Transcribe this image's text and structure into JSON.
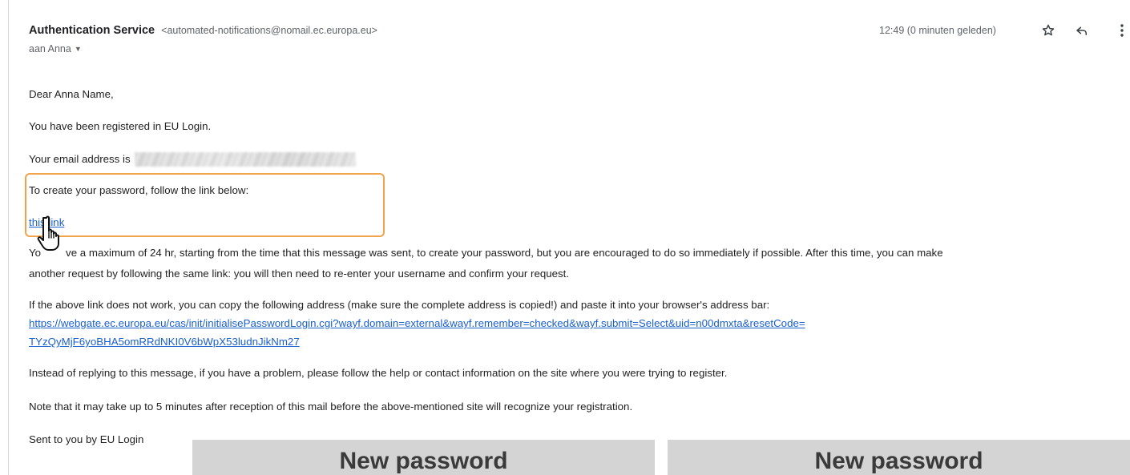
{
  "email": {
    "sender_name": "Authentication Service",
    "sender_address": "<automated-notifications@nomail.ec.europa.eu>",
    "recipient": "aan Anna",
    "timestamp": "12:49 (0 minuten geleden)",
    "icons": {
      "star": "star-icon",
      "reply": "reply-icon",
      "more": "more-vert-icon",
      "caret": "chevron-down-icon"
    }
  },
  "body": {
    "greeting": "Dear Anna Name,",
    "registered": "You have been registered in EU Login.",
    "email_address_label": "Your email address is",
    "create_password": "To create your password, follow the link below:",
    "this_link": "this link",
    "maximum_line_1_start": "Yo",
    "maximum_line_1_rest": "ve a maximum of 24 hr, starting from the time that this message was sent, to create your password, but you are encouraged to do so immediately if possible. After this time, you can make",
    "maximum_line_2": "another request by following the same link: you will then need to re-enter your username and confirm your request.",
    "copy_address": "If the above link does not work, you can copy the following address (make sure the complete address is copied!) and paste it into your browser's address bar:",
    "url_line_1": "https://webgate.ec.europa.eu/cas/init/initialisePasswordLogin.cgi?wayf.domain=external&wayf.remember=checked&wayf.submit=Select&uid=n00dmxta&resetCode=",
    "url_line_2": "TYzQyMjF6yoBHA5omRRdNKI0V6bWpX53ludnJikNm27",
    "instead_reply": "Instead of replying to this message, if you have a problem, please follow the help or contact information on the site where you were trying to register.",
    "note_minutes": "Note that it may take up to 5 minutes after reception of this mail before the above-mentioned site will recognize your registration.",
    "sent_by": "Sent to you by EU Login"
  },
  "overlay": {
    "banner_left": "New password",
    "banner_right": "New password",
    "highlight_color": "#f0a34b",
    "cursor_icon": "hand-pointer-icon"
  },
  "colors": {
    "link": "#1a5fcc",
    "banner_bg": "#d4d4d4"
  }
}
